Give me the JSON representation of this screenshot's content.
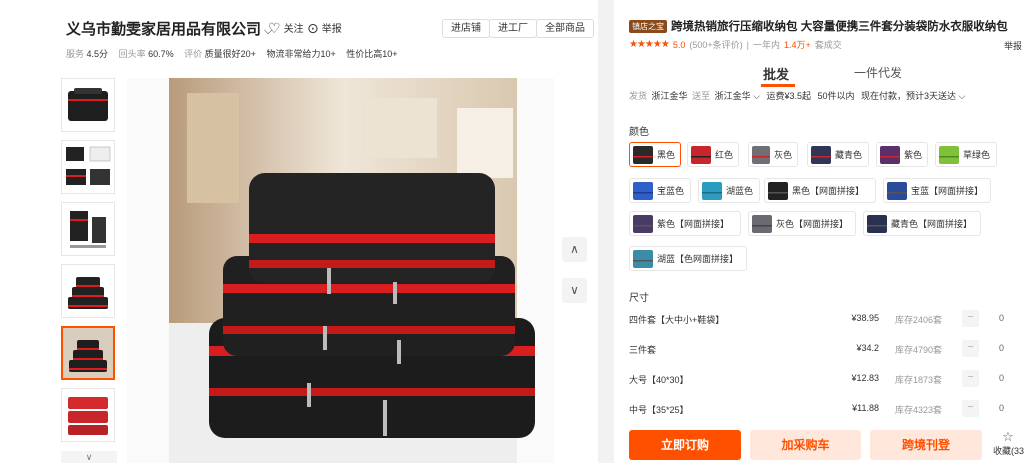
{
  "shop": {
    "name": "义乌市勤雯家居用品有限公司",
    "follow_label": "关注",
    "report_label": "举报",
    "buttons": [
      "进店铺",
      "进工厂",
      "全部商品"
    ],
    "stats": {
      "service_label": "服务",
      "service_value": "4.5分",
      "repurchase_label": "回头率",
      "repurchase_value": "60.7%",
      "review_label": "评价",
      "quality_label": "质量很好20+",
      "logistics_label": "物流非常给力10+",
      "value_label": "性价比高10+"
    }
  },
  "gallery": {
    "thumbnail_count": 6,
    "selected_index": 4
  },
  "product": {
    "badge": "镇店之宝",
    "title": "跨境热销旅行压缩收纳包 大容量便携三件套分装袋防水衣服收纳包",
    "stars": "★★★★★",
    "score": "5.0",
    "reviews": "(500+条评价)",
    "sold_prefix": "一年内",
    "sold_count": "1.4万+",
    "sold_suffix": "套成交",
    "cut_right": "举报"
  },
  "tabs": {
    "wholesale": "批发",
    "dropship": "一件代发"
  },
  "shipping": {
    "label": "发货",
    "from": "浙江金华",
    "to_label": "送至",
    "to": "浙江金华 ⌵",
    "freight": "运费¥3.5起",
    "qty": "50件以内",
    "eta": "现在付款，预计3天送达 ⌵"
  },
  "color": {
    "label": "颜色",
    "options": [
      {
        "label": "黑色",
        "swatch": "#2a2a2a",
        "accent": "#d81e1e",
        "selected": true
      },
      {
        "label": "红色",
        "swatch": "#c8262a",
        "accent": "#222222",
        "selected": false
      },
      {
        "label": "灰色",
        "swatch": "#6f6f75",
        "accent": "#c8262a",
        "selected": false
      },
      {
        "label": "藏青色",
        "swatch": "#2f3658",
        "accent": "#c8262a",
        "selected": false
      },
      {
        "label": "紫色",
        "swatch": "#5a2f6a",
        "accent": "#c8262a",
        "selected": false
      },
      {
        "label": "草绿色",
        "swatch": "#7fc23a",
        "accent": "#4f8a1f",
        "selected": false
      },
      {
        "label": "宝蓝色",
        "swatch": "#2f5fc8",
        "accent": "#1d3e8c",
        "selected": false
      },
      {
        "label": "湖蓝色",
        "swatch": "#2b9cc0",
        "accent": "#1b6c88",
        "selected": false
      },
      {
        "label": "黑色【网面拼接】",
        "swatch": "#222222",
        "accent": "#555555",
        "selected": false
      },
      {
        "label": "宝蓝【网面拼接】",
        "swatch": "#2a4a9a",
        "accent": "#555555",
        "selected": false
      },
      {
        "label": "紫色【网面拼接】",
        "swatch": "#4a3a66",
        "accent": "#555555",
        "selected": false
      },
      {
        "label": "灰色【网面拼接】",
        "swatch": "#6a6a72",
        "accent": "#444444",
        "selected": false
      },
      {
        "label": "藏青色【网面拼接】",
        "swatch": "#2a3050",
        "accent": "#555555",
        "selected": false
      },
      {
        "label": "湖蓝【色网面拼接】",
        "swatch": "#3a8ca8",
        "accent": "#555555",
        "selected": false
      }
    ]
  },
  "size": {
    "label": "尺寸",
    "options": [
      {
        "name": "四件套【大中小+鞋袋】",
        "price": "¥38.95",
        "stock": "库存2406套",
        "qty": "0"
      },
      {
        "name": "三件套",
        "price": "¥34.2",
        "stock": "库存4790套",
        "qty": "0"
      },
      {
        "name": "大号【40*30】",
        "price": "¥12.83",
        "stock": "库存1873套",
        "qty": "0"
      },
      {
        "name": "中号【35*25】",
        "price": "¥11.88",
        "stock": "库存4323套",
        "qty": "0"
      }
    ]
  },
  "actions": {
    "order": "立即订购",
    "cart": "加采购车",
    "cross_border": "跨境刊登",
    "favorite": "收藏(33"
  },
  "colors": {
    "accent": "#ff5000",
    "accent_light": "#ffe7dc"
  }
}
